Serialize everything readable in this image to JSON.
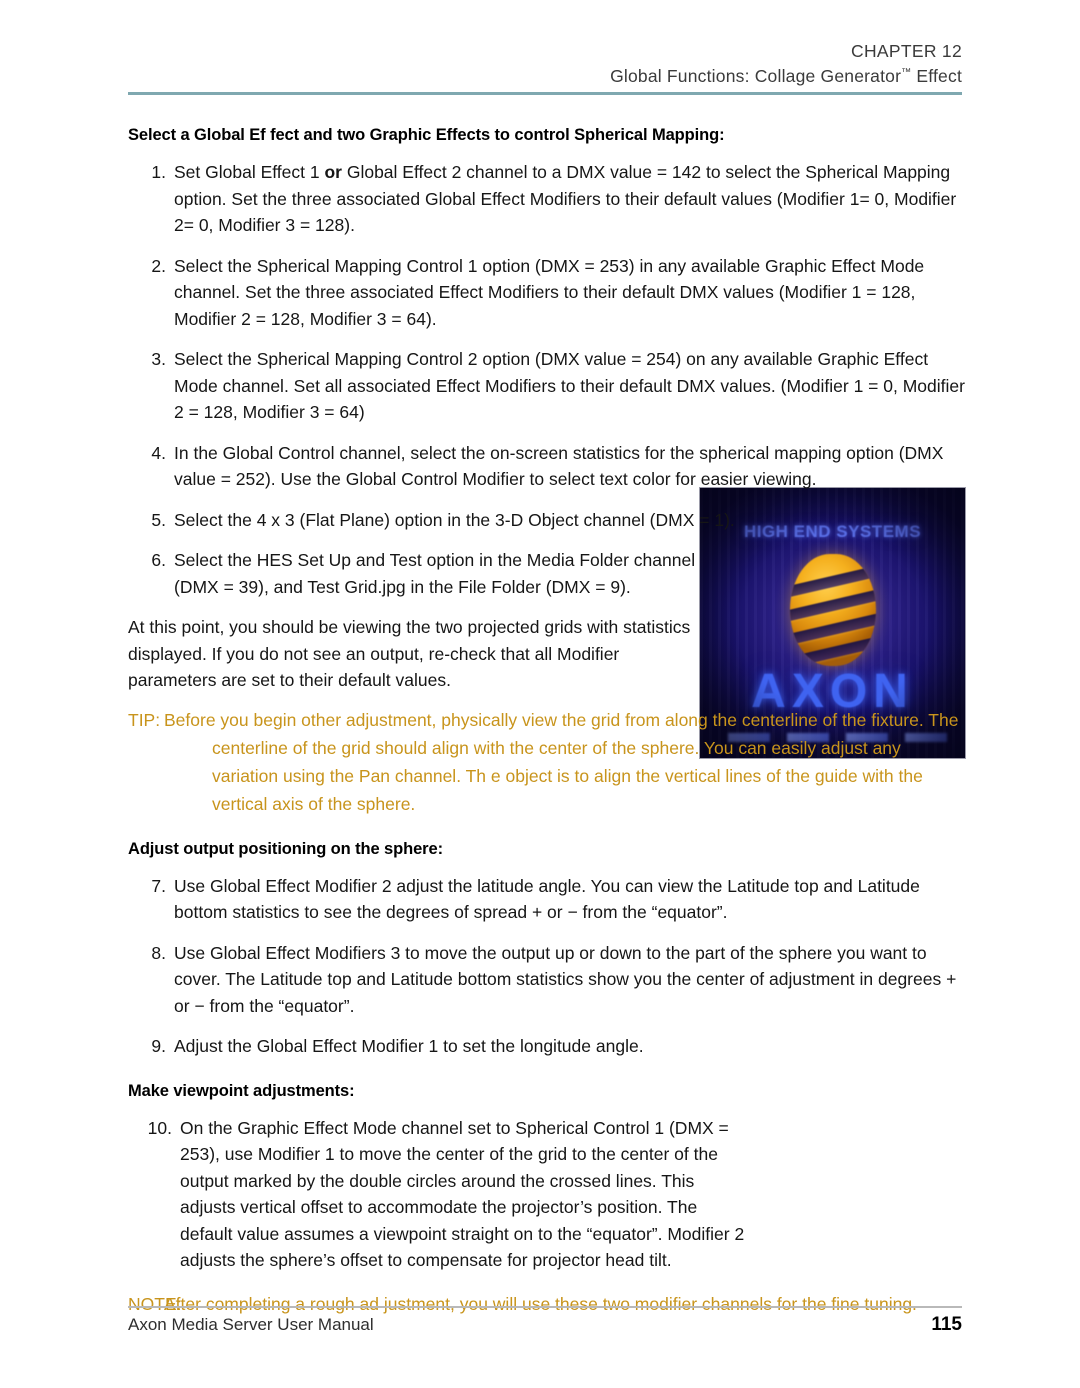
{
  "header": {
    "chapter": "CHAPTER 12",
    "title_before": "Global Functions: Collage Generator",
    "trademark": "™",
    "title_after": " Effect"
  },
  "section_1": {
    "heading": "Select a Global Ef    fect and two Graphic Effects to control Spherical Mapping:",
    "items": [
      {
        "num": "1.",
        "text_before_bold": "Set Global Effect 1      ",
        "bold": "or",
        "text_after_bold": " Global Effect 2      channel to a DMX value = 142 to select the Spherical Mapping option. Set the three associated Global Effect Modifiers to their default values (Modifier 1= 0, Modifier 2= 0, Modifier 3 =  128)."
      },
      {
        "num": "2.",
        "text": "Select the Spherical Mapping Control 1 option (DMX = 253) in any available Graphic Effect Mode  channel. Set the three associated Effect Modifiers to their default DMX values (Modifier 1 =  128, Modifier 2 =  128, Modifier 3 =  64)."
      },
      {
        "num": "3.",
        "text": "Select the Spherical Mapping Control 2 option (DMX value = 254) on any available Graphic Effect Mode     channel. Set all associated Effect Modifiers to their default DMX values. (Modifier 1 =  0, Modifier 2 =  128, Modifier 3 =  64)"
      },
      {
        "num": "4.",
        "text": "In the Global Control       channel, select the on-screen statistics for the spherical mapping option (DMX value = 252). Use the Global Control Modifier        to select text color for easier viewing."
      },
      {
        "num": "5.",
        "text": "Select the 4 x 3 (Flat Plane) option in the 3-D Object channel (DMX =  1)."
      },
      {
        "num": "6.",
        "text": "Select the HES Set Up and Test option in the Media Folder channel (DMX =  39), and Test Grid.jpg in the File Folder (DMX =  9)."
      }
    ],
    "paragraph": "At this point, you should be viewing the two projected grids with statistics displayed. If you do not see an output, re-check that all Modifier parameters are set to their default values."
  },
  "tip": {
    "label": "TIP:",
    "text": "Before you begin other    adjustment, physically view the grid from along the centerline of the fixture. The centerline of the grid should align with      the center of the sphere. You can easily adjust any variation using the Pan channel. Th     e object is to align the vertical lines of the guide with the vertical axis of the sphere."
  },
  "section_2": {
    "heading": "Adjust output positioning on the sphere:",
    "items": [
      {
        "num": "7.",
        "text": "Use Global Effect Modifier 2        adjust the latitude angle. You can view the Latitude top and Latitude bottom statistics to see the degrees of spread + or − from the “equator”."
      },
      {
        "num": "8.",
        "text": "Use Global Effect Modifiers 3        to move the output up or down to the part of the sphere you want to cover. The Latitude top and Latitude bottom statistics show you the center of adjustment in degrees + or − from the “equator”."
      },
      {
        "num": "9.",
        "text": "Adjust the Global Effect Modifier 1       to set the longitude angle."
      }
    ]
  },
  "section_3": {
    "heading": "Make viewpoint adjustments:",
    "items": [
      {
        "num": "10.",
        "text": "On the Graphic Effect Mode       channel set to Spherical Control 1 (DMX = 253), use Modifier 1     to move the center of the grid to the center of the output marked by the double circles around the crossed lines. This adjusts vertical offset to accommodate the projector’s position. The default value assumes a viewpoint straight on to the “equator”. Modifier 2 adjusts the sphere’s offset to compensate for projector head tilt."
      }
    ]
  },
  "note": {
    "label": "NOTE:",
    "text": "After completing a rough ad    justment, you will use these two modifier channels for the fine tuning."
  },
  "figure": {
    "brand_top": "HIGH END SYSTEMS",
    "brand_main": "AXON"
  },
  "footer": {
    "manual_title": "Axon Media Server User Manual",
    "page_number": "115"
  },
  "colors": {
    "header_rule": "#7fa8b0",
    "callout_text": "#c8941c",
    "footer_rule": "#b9b9b9",
    "figure_bg": "#18116a",
    "figure_sphere": "#f5b01e",
    "figure_axon": "#3f63f0"
  }
}
